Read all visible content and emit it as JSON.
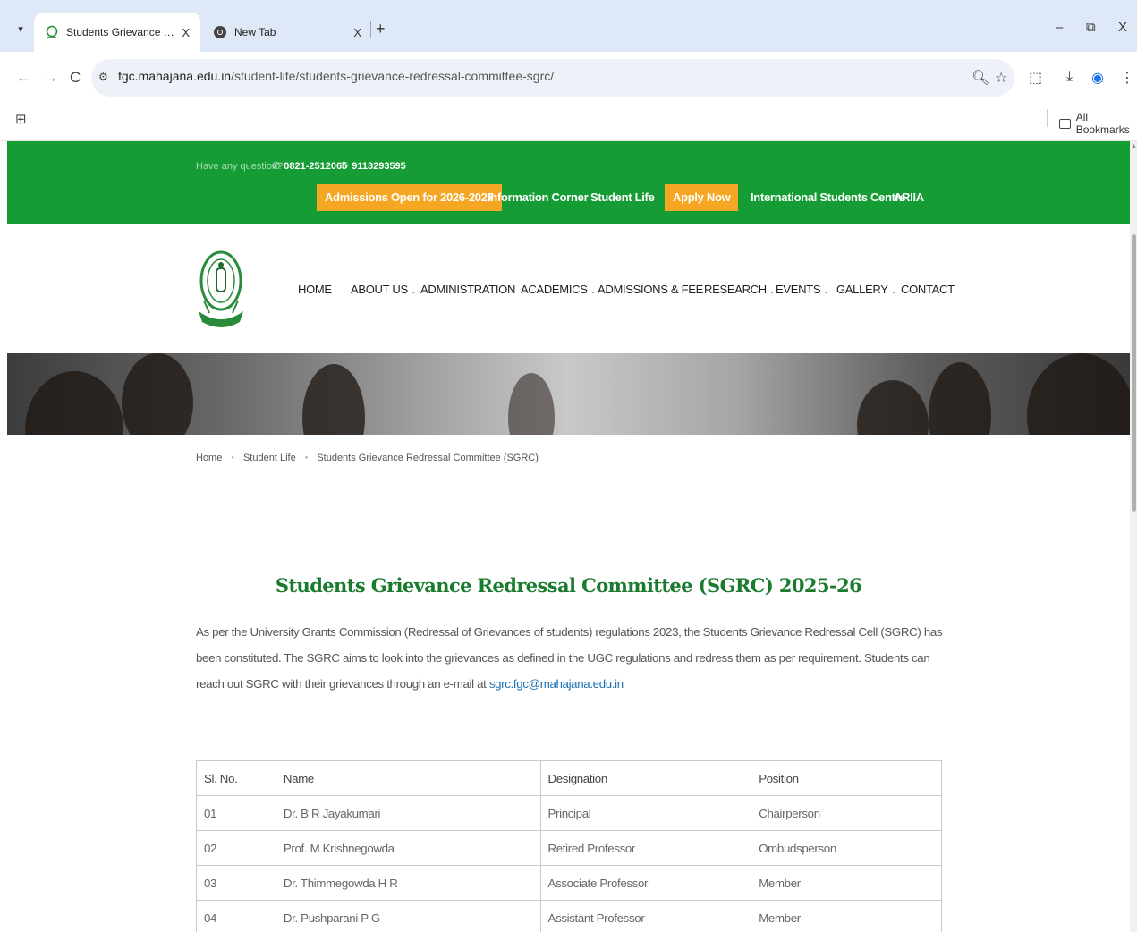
{
  "browser": {
    "tabs": [
      {
        "title": "Students Grievance Redressal C",
        "close": "X"
      },
      {
        "title": "New Tab",
        "close": "X"
      }
    ],
    "new_tab": "+",
    "window_controls": {
      "minimize": "–",
      "restore": "⧉",
      "close": "X"
    },
    "nav": {
      "back": "←",
      "forward": "→",
      "reload": "C"
    },
    "url_host": "fgc.mahajana.edu.in",
    "url_path": "/student-life/students-grievance-redressal-committee-sgrc/",
    "all_bookmarks": "All Bookmarks"
  },
  "topbar": {
    "question": "Have any question?",
    "phone1": "0821-2512065",
    "phone2": "9113293595",
    "nav": [
      {
        "label": "Admissions Open for 2026-2027",
        "highlight": true
      },
      {
        "label": "Information Corner",
        "highlight": false
      },
      {
        "label": "Student Life",
        "highlight": false
      },
      {
        "label": "Apply Now",
        "highlight": true
      },
      {
        "label": "International Students Centre",
        "highlight": false
      },
      {
        "label": "ARIIA",
        "highlight": false
      }
    ]
  },
  "menu": [
    {
      "label": "HOME",
      "dropdown": false
    },
    {
      "label": "ABOUT US",
      "dropdown": true
    },
    {
      "label": "ADMINISTRATION",
      "dropdown": false
    },
    {
      "label": "ACADEMICS",
      "dropdown": true
    },
    {
      "label": "ADMISSIONS & FEE",
      "dropdown": false
    },
    {
      "label": "RESEARCH",
      "dropdown": true
    },
    {
      "label": "EVENTS",
      "dropdown": true
    },
    {
      "label": "GALLERY",
      "dropdown": true
    },
    {
      "label": "CONTACT",
      "dropdown": false
    }
  ],
  "breadcrumb": [
    "Home",
    "Student Life",
    "Students Grievance Redressal Committee (SGRC)"
  ],
  "page": {
    "title": "Students Grievance Redressal Committee (SGRC) 2025-26",
    "intro": "As per the University Grants Commission (Redressal of Grievances of students) regulations 2023, the Students Grievance Redressal Cell (SGRC) has been constituted.  The SGRC aims to look into the grievances as defined in the UGC regulations and redress them as per requirement.  Students can reach out SGRC with their grievances through an e-mail at ",
    "email": "sgrc.fgc@mahajana.edu.in"
  },
  "table": {
    "headers": [
      "Sl. No.",
      "Name",
      "Designation",
      "Position"
    ],
    "rows": [
      [
        "01",
        "Dr. B R Jayakumari",
        "Principal",
        "Chairperson"
      ],
      [
        "02",
        "Prof. M Krishnegowda",
        "Retired Professor",
        "Ombudsperson"
      ],
      [
        "03",
        "Dr. Thimmegowda H R",
        "Associate Professor",
        "Member"
      ],
      [
        "04",
        "Dr. Pushparani P G",
        "Assistant Professor",
        "Member"
      ]
    ]
  },
  "colors": {
    "topbar_green": "#169c34",
    "highlight_orange": "#f5a623",
    "title_green": "#1a7a2d",
    "link_blue": "#1a6fb5"
  }
}
